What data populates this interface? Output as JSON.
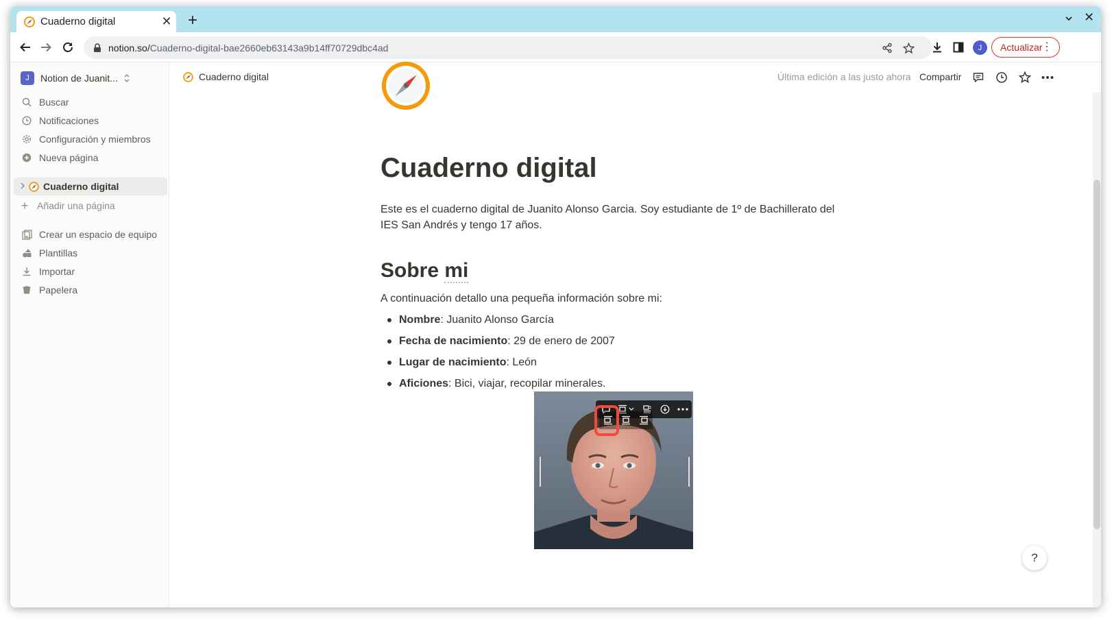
{
  "browser": {
    "tab_title": "Cuaderno digital",
    "url_host": "notion.so/",
    "url_path": "Cuaderno-digital-bae2660eb63143a9b14ff70729dbc4ad",
    "update_label": "Actualizar",
    "profile_initial": "J",
    "update_color": "#d93025"
  },
  "sidebar": {
    "workspace_initial": "J",
    "workspace_name": "Notion de Juanit...",
    "items": [
      {
        "label": "Buscar",
        "icon": "search-icon"
      },
      {
        "label": "Notificaciones",
        "icon": "clock-icon"
      },
      {
        "label": "Configuración y miembros",
        "icon": "gear-icon"
      },
      {
        "label": "Nueva página",
        "icon": "plus-circle-icon"
      }
    ],
    "page": "Cuaderno digital",
    "add_page": "Añadir una página",
    "bottom_items": [
      {
        "label": "Crear un espacio de equipo",
        "icon": "team-space-icon"
      },
      {
        "label": "Plantillas",
        "icon": "templates-icon"
      },
      {
        "label": "Importar",
        "icon": "import-icon"
      },
      {
        "label": "Papelera",
        "icon": "trash-icon"
      }
    ]
  },
  "topbar": {
    "breadcrumb": "Cuaderno digital",
    "edited": "Última edición a las justo ahora",
    "share": "Compartir"
  },
  "page": {
    "title": "Cuaderno digital",
    "intro": "Este es el cuaderno digital de Juanito Alonso Garcia. Soy estudiante de 1º de Bachillerato del IES San Andrés y tengo 17 años.",
    "h2_prefix": "Sobre ",
    "h2_underlined": "mi",
    "paragraph": "A continuación detallo una pequeña información sobre mi:",
    "bullets": [
      {
        "key": "Nombre",
        "value": ": Juanito Alonso García"
      },
      {
        "key": "Fecha de nacimiento",
        "value": ": 29 de enero de 2007"
      },
      {
        "key": "Lugar de nacimiento",
        "value": ": León"
      },
      {
        "key": "Aficiones",
        "value": ": Bici, viajar, recopilar minerales."
      }
    ]
  },
  "help_label": "?"
}
